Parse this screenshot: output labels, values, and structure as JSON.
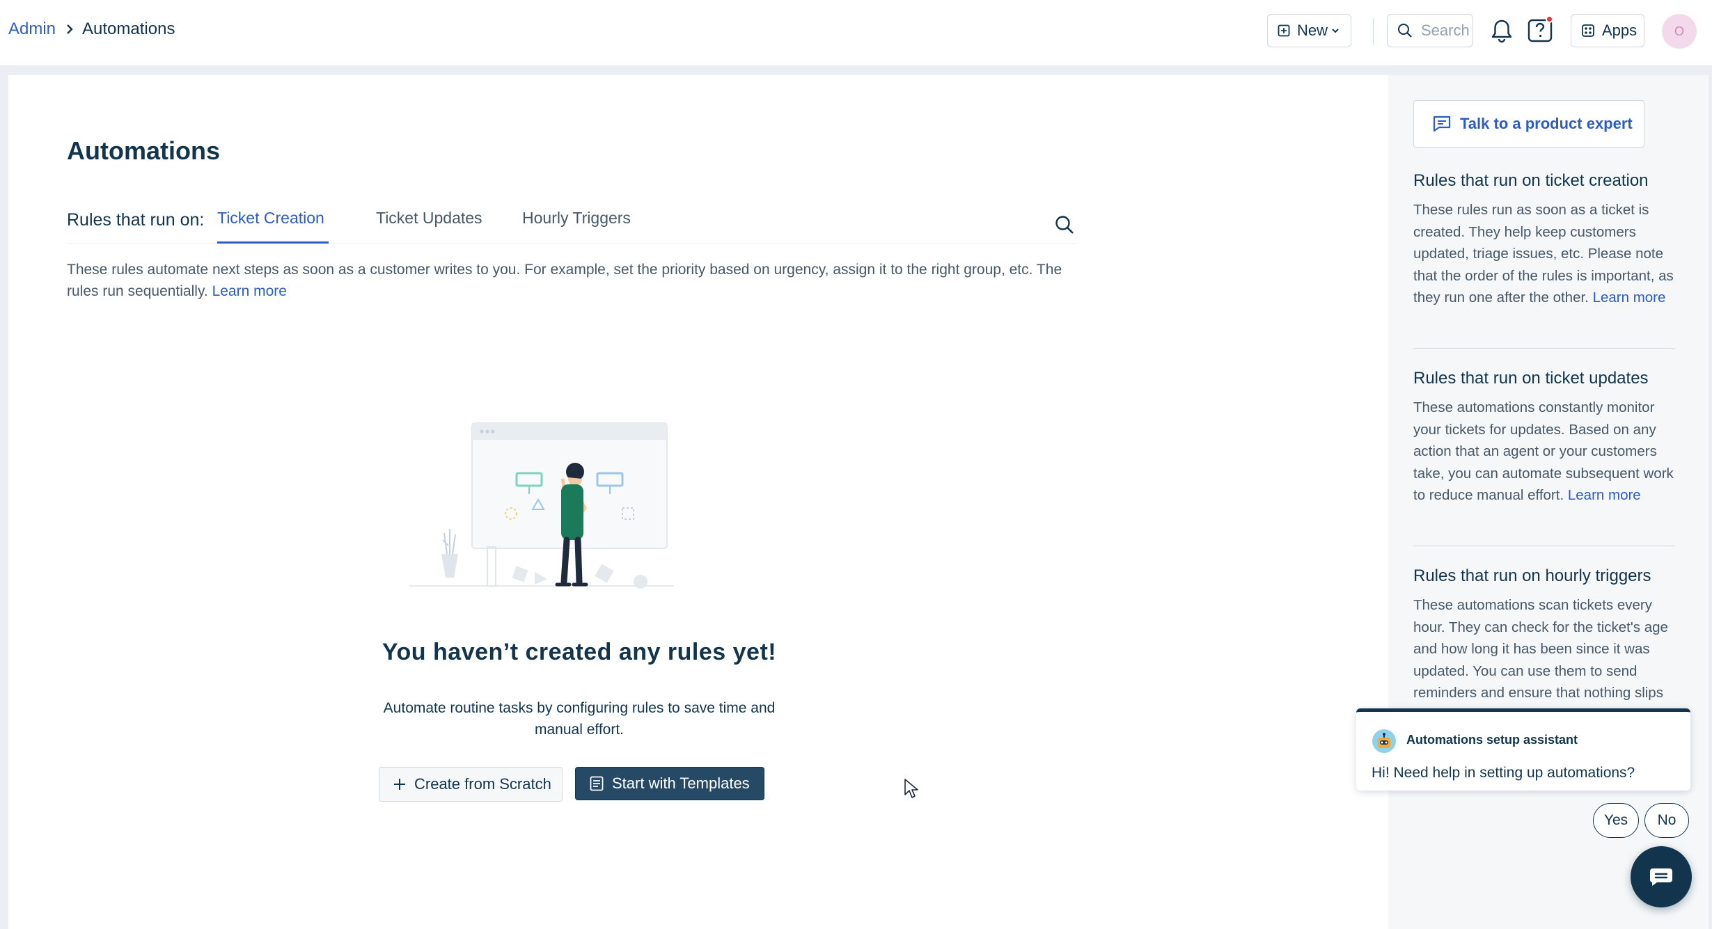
{
  "header": {
    "breadcrumb": {
      "parent": "Admin",
      "current": "Automations"
    },
    "new_label": "New",
    "search_placeholder": "Search",
    "apps_label": "Apps",
    "avatar_initial": "O"
  },
  "main": {
    "title": "Automations",
    "tabs_label": "Rules that run on:",
    "tabs": [
      {
        "label": "Ticket Creation",
        "active": true
      },
      {
        "label": "Ticket Updates",
        "active": false
      },
      {
        "label": "Hourly Triggers",
        "active": false
      }
    ],
    "description": "These rules automate next steps as soon as a customer writes to you. For example, set the priority based on urgency, assign it to the right group, etc. The rules run sequentially.",
    "learn_more": "Learn more",
    "empty_state": {
      "title": "You haven’t created any rules yet!",
      "subtitle": "Automate routine tasks by configuring rules to save time and manual effort.",
      "create_label": "Create from Scratch",
      "templates_label": "Start with Templates"
    }
  },
  "side_panel": {
    "expert_label": "Talk to a product expert",
    "sections": [
      {
        "title": "Rules that run on ticket creation",
        "body": "These rules run as soon as a ticket is created. They help keep customers updated, triage issues, etc. Please note that the order of the rules is important, as they run one after the other.",
        "link": "Learn more"
      },
      {
        "title": "Rules that run on ticket updates",
        "body": "These automations constantly monitor your tickets for updates. Based on any action that an agent or your customers take, you can automate subsequent work to reduce manual effort.",
        "link": "Learn more"
      },
      {
        "title": "Rules that run on hourly triggers",
        "body": "These automations scan tickets every hour. They can check for the ticket's age and how long it has been since it was updated. You can use them to send reminders and ensure that nothing slips"
      }
    ]
  },
  "chat": {
    "assistant_name": "Automations setup assistant",
    "message": "Hi! Need help in setting up automations?",
    "yes_label": "Yes",
    "no_label": "No"
  },
  "colors": {
    "brand_dark": "#12344d",
    "link_blue": "#2c5cc5",
    "muted_text": "#475867",
    "page_bg": "#ebeff3",
    "panel_bg": "#f5f7f9",
    "primary_button": "#264966",
    "notification_dot": "#e43538"
  },
  "icons": [
    "new-icon",
    "chevron-down-icon",
    "search-icon",
    "bell-icon",
    "help-icon",
    "apps-icon",
    "chat-bubble-icon",
    "plus-icon",
    "template-icon",
    "bot-avatar-icon",
    "chat-launcher-icon"
  ]
}
